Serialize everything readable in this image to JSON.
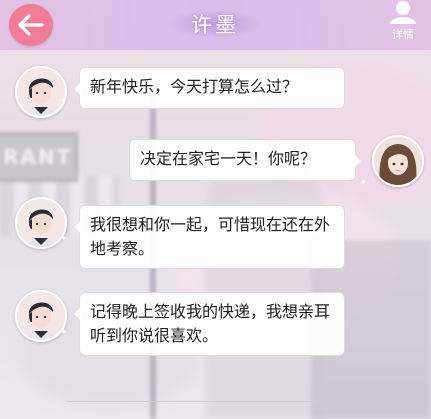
{
  "header": {
    "title": "许墨",
    "detail_label": "详情",
    "back_icon": "arrow-left-icon",
    "detail_icon": "person-icon",
    "back_color": "#f27b97"
  },
  "messages": [
    {
      "sender": "许墨",
      "side": "left",
      "text": "新年快乐，今天打算怎么过？"
    },
    {
      "sender": "player",
      "side": "right",
      "text": "决定在家宅一天！你呢？"
    },
    {
      "sender": "许墨",
      "side": "left",
      "text": "我很想和你一起，可惜现在还在外地考察。"
    },
    {
      "sender": "许墨",
      "side": "left",
      "text": "记得晚上签收我的快递，我想亲耳听到你说很喜欢。"
    }
  ],
  "background": {
    "sign_text": "RANT"
  }
}
